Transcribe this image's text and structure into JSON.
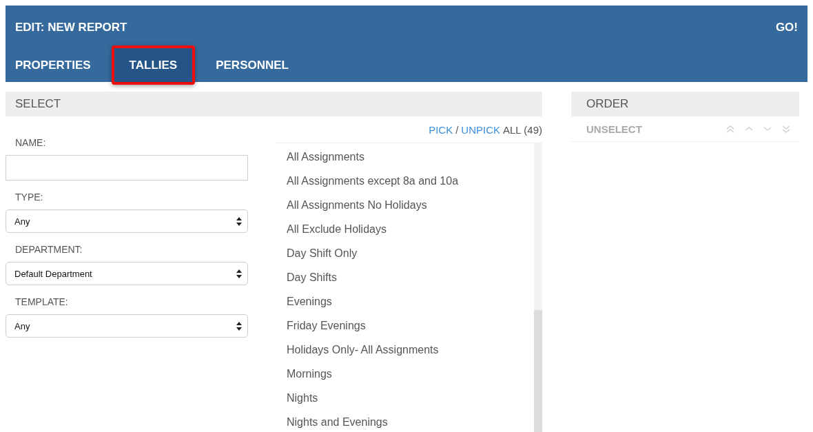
{
  "header": {
    "title": "EDIT: NEW REPORT",
    "action": "GO!"
  },
  "tabs": [
    {
      "label": "PROPERTIES",
      "selected": false
    },
    {
      "label": "TALLIES",
      "selected": true
    },
    {
      "label": "PERSONNEL",
      "selected": false
    }
  ],
  "select_panel": {
    "title": "SELECT",
    "fields": [
      {
        "label": "NAME:",
        "kind": "text"
      },
      {
        "label": "TYPE:",
        "kind": "dropdown",
        "value": "Any"
      },
      {
        "label": "DEPARTMENT:",
        "kind": "dropdown",
        "value": "Default Department"
      },
      {
        "label": "TEMPLATE:",
        "kind": "dropdown",
        "value": "Any"
      }
    ],
    "pick_all": {
      "pick": "PICK",
      "separator": "/",
      "unpick": "UNPICK",
      "suffix": "ALL (49)"
    },
    "items": [
      "All Assignments",
      "All Assignments except 8a and 10a",
      "All Assignments No Holidays",
      "All Exclude Holidays",
      "Day Shift Only",
      "Day Shifts",
      "Evenings",
      "Friday Evenings",
      "Holidays Only- All Assignments",
      "Mornings",
      "Nights",
      "Nights and Evenings"
    ]
  },
  "order_panel": {
    "title": "ORDER",
    "unselect": {
      "label": "UNSELECT",
      "disabled": true
    }
  }
}
